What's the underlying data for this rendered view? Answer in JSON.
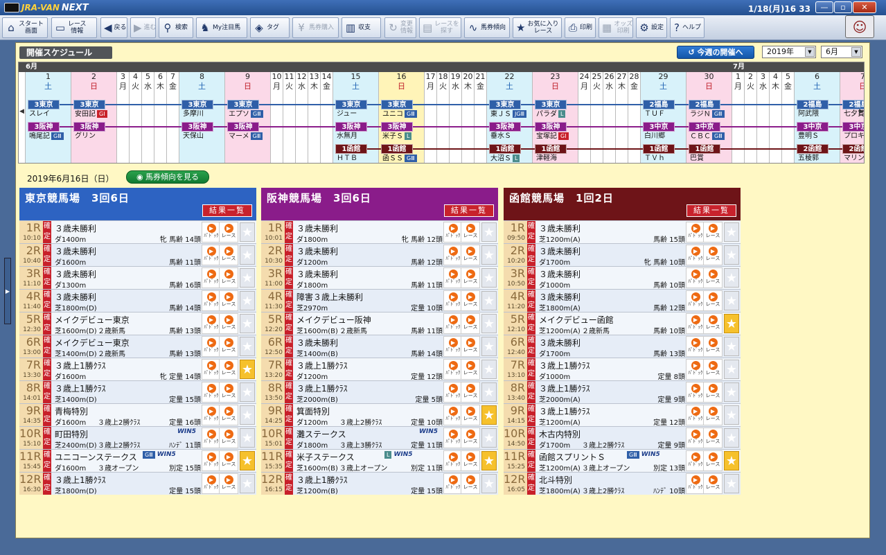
{
  "app": {
    "logo_main": "JRA-VAN",
    "logo_sub": "NEXT",
    "clock": "1/18(月)16 33"
  },
  "window_buttons": [
    "—",
    "▫",
    "✕"
  ],
  "toolbar": [
    {
      "label": "スタート\n画面",
      "icon": "home-icon",
      "glyph": "⌂",
      "enabled": true
    },
    {
      "label": "レース\n情報",
      "icon": "race-info-icon",
      "glyph": "▭",
      "enabled": true
    },
    {
      "label": "戻る",
      "icon": "back-icon",
      "glyph": "◀",
      "enabled": true
    },
    {
      "label": "進む",
      "icon": "forward-icon",
      "glyph": "▶",
      "enabled": false
    },
    {
      "label": "検索",
      "icon": "search-icon",
      "glyph": "⚲",
      "enabled": true
    },
    {
      "label": "My注目馬",
      "icon": "horse-icon",
      "glyph": "♞",
      "enabled": true
    },
    {
      "label": "タグ",
      "icon": "tag-icon",
      "glyph": "◈",
      "enabled": true
    },
    {
      "label": "馬券購入",
      "icon": "yen-icon",
      "glyph": "¥",
      "enabled": false
    },
    {
      "label": "収支",
      "icon": "balance-chart-icon",
      "glyph": "▥",
      "enabled": true
    },
    {
      "label": "変更\n情報",
      "icon": "change-info-icon",
      "glyph": "↻",
      "enabled": false
    },
    {
      "label": "レースを\n探す",
      "icon": "find-race-icon",
      "glyph": "▤",
      "enabled": false
    },
    {
      "label": "馬券傾向",
      "icon": "trend-icon",
      "glyph": "∿",
      "enabled": true
    },
    {
      "label": "お気に入り\nレース",
      "icon": "star-icon",
      "glyph": "★",
      "enabled": true
    },
    {
      "label": "印刷",
      "icon": "print-icon",
      "glyph": "⎙",
      "enabled": true
    },
    {
      "label": "オッズ\n印刷",
      "icon": "odds-print-icon",
      "glyph": "▦",
      "enabled": false
    },
    {
      "label": "設定",
      "icon": "gear-icon",
      "glyph": "⚙",
      "enabled": true
    },
    {
      "label": "ヘルプ",
      "icon": "help-icon",
      "glyph": "?",
      "enabled": true
    }
  ],
  "schedule": {
    "title": "開催スケジュール",
    "this_week_button": "今週の開催へ",
    "year_value": "2019年",
    "month_value": "6月",
    "month_labels": [
      "6月",
      "7月"
    ]
  },
  "calendar": {
    "days": [
      {
        "d": "1",
        "w": "土"
      },
      {
        "d": "2",
        "w": "日"
      },
      {
        "d": "3",
        "w": "月"
      },
      {
        "d": "4",
        "w": "火"
      },
      {
        "d": "5",
        "w": "水"
      },
      {
        "d": "6",
        "w": "木"
      },
      {
        "d": "7",
        "w": "金"
      },
      {
        "d": "8",
        "w": "土"
      },
      {
        "d": "9",
        "w": "日"
      },
      {
        "d": "10",
        "w": "月"
      },
      {
        "d": "11",
        "w": "火"
      },
      {
        "d": "12",
        "w": "水"
      },
      {
        "d": "13",
        "w": "木"
      },
      {
        "d": "14",
        "w": "金"
      },
      {
        "d": "15",
        "w": "土"
      },
      {
        "d": "16",
        "w": "日"
      },
      {
        "d": "17",
        "w": "月"
      },
      {
        "d": "18",
        "w": "火"
      },
      {
        "d": "19",
        "w": "水"
      },
      {
        "d": "20",
        "w": "木"
      },
      {
        "d": "21",
        "w": "金"
      },
      {
        "d": "22",
        "w": "土"
      },
      {
        "d": "23",
        "w": "日"
      },
      {
        "d": "24",
        "w": "月"
      },
      {
        "d": "25",
        "w": "火"
      },
      {
        "d": "26",
        "w": "水"
      },
      {
        "d": "27",
        "w": "木"
      },
      {
        "d": "28",
        "w": "金"
      },
      {
        "d": "29",
        "w": "土"
      },
      {
        "d": "30",
        "w": "日"
      },
      {
        "d": "1",
        "w": "月"
      },
      {
        "d": "2",
        "w": "火"
      },
      {
        "d": "3",
        "w": "水"
      },
      {
        "d": "4",
        "w": "木"
      },
      {
        "d": "5",
        "w": "金"
      },
      {
        "d": "6",
        "w": "土"
      },
      {
        "d": "7",
        "w": "日"
      }
    ],
    "rows": [
      {
        "color": "#2f5fa8",
        "events": [
          {
            "di": 0,
            "v": "3東京",
            "g": "スレイ",
            "gr": ""
          },
          {
            "di": 1,
            "v": "3東京",
            "g": "安田記",
            "gr": "GⅠ"
          },
          {
            "di": 7,
            "v": "3東京",
            "g": "多摩川",
            "gr": ""
          },
          {
            "di": 8,
            "v": "3東京",
            "g": "エプソ",
            "gr": "GⅢ"
          },
          {
            "di": 14,
            "v": "3東京",
            "g": "ジュー",
            "gr": ""
          },
          {
            "di": 15,
            "v": "3東京",
            "g": "ユニコ",
            "gr": "GⅢ"
          },
          {
            "di": 21,
            "v": "3東京",
            "g": "東ＪＳ",
            "gr": "JGⅢ"
          },
          {
            "di": 22,
            "v": "3東京",
            "g": "パラダ",
            "gr": "L"
          },
          {
            "di": 28,
            "v": "2福島",
            "g": "ＴＵＦ",
            "gr": ""
          },
          {
            "di": 29,
            "v": "2福島",
            "g": "ラジＮ",
            "gr": "GⅢ"
          },
          {
            "di": 35,
            "v": "2福島",
            "g": "阿武隈",
            "gr": ""
          },
          {
            "di": 36,
            "v": "2福島",
            "g": "七夕賞",
            "gr": ""
          }
        ]
      },
      {
        "color": "#8a1c8a",
        "events": [
          {
            "di": 0,
            "v": "3阪神",
            "g": "鳴尾記",
            "gr": "GⅢ"
          },
          {
            "di": 1,
            "v": "3阪神",
            "g": "グリン",
            "gr": ""
          },
          {
            "di": 7,
            "v": "3阪神",
            "g": "天保山",
            "gr": ""
          },
          {
            "di": 8,
            "v": "3阪神",
            "g": "マーメ",
            "gr": "GⅢ"
          },
          {
            "di": 14,
            "v": "3阪神",
            "g": "水無月",
            "gr": ""
          },
          {
            "di": 15,
            "v": "3阪神",
            "g": "米子Ｓ",
            "gr": "L"
          },
          {
            "di": 21,
            "v": "3阪神",
            "g": "垂水Ｓ",
            "gr": ""
          },
          {
            "di": 22,
            "v": "3阪神",
            "g": "宝塚記",
            "gr": "GⅠ"
          },
          {
            "di": 28,
            "v": "3中京",
            "g": "白川郷",
            "gr": ""
          },
          {
            "di": 29,
            "v": "3中京",
            "g": "ＣＢＣ",
            "gr": "GⅢ"
          },
          {
            "di": 35,
            "v": "3中京",
            "g": "豊明Ｓ",
            "gr": ""
          },
          {
            "di": 36,
            "v": "3中京",
            "g": "プロキ",
            "gr": ""
          }
        ]
      },
      {
        "color": "#6e1418",
        "events": [
          {
            "di": 14,
            "v": "1函館",
            "g": "ＨＴＢ",
            "gr": ""
          },
          {
            "di": 15,
            "v": "1函館",
            "g": "函ＳＳ",
            "gr": "GⅢ"
          },
          {
            "di": 21,
            "v": "1函館",
            "g": "大沼Ｓ",
            "gr": "L"
          },
          {
            "di": 22,
            "v": "1函館",
            "g": "津軽海",
            "gr": ""
          },
          {
            "di": 28,
            "v": "1函館",
            "g": "ＴＶｈ",
            "gr": ""
          },
          {
            "di": 29,
            "v": "1函館",
            "g": "巴賞",
            "gr": ""
          },
          {
            "di": 35,
            "v": "2函館",
            "g": "五稜郭",
            "gr": ""
          },
          {
            "di": 36,
            "v": "2函館",
            "g": "マリン",
            "gr": ""
          }
        ]
      }
    ]
  },
  "selected_date": "2019年6月16日（日）",
  "trend_button": "馬券傾向を見る",
  "result_button": "結果一覧",
  "kakutei": "確定",
  "icon_labels": {
    "paddock": "ﾊﾟﾄﾞｯｸ",
    "race": "レース"
  },
  "venues": [
    {
      "name": "東京競馬場　3回6日",
      "color": "#2d63c2",
      "races": [
        {
          "no": "1R",
          "time": "10:10",
          "name": "３歳未勝利",
          "course": "ダ1400m",
          "cond": "",
          "info": "牝 馬齢 14頭",
          "grades": [],
          "w5": false,
          "fav": false
        },
        {
          "no": "2R",
          "time": "10:40",
          "name": "３歳未勝利",
          "course": "ダ1600m",
          "cond": "",
          "info": "馬齢 11頭",
          "grades": [],
          "w5": false,
          "fav": false
        },
        {
          "no": "3R",
          "time": "11:10",
          "name": "３歳未勝利",
          "course": "ダ1300m",
          "cond": "",
          "info": "馬齢 16頭",
          "grades": [],
          "w5": false,
          "fav": false
        },
        {
          "no": "4R",
          "time": "11:40",
          "name": "３歳未勝利",
          "course": "芝1800m(D)",
          "cond": "",
          "info": "馬齢 14頭",
          "grades": [],
          "w5": false,
          "fav": false
        },
        {
          "no": "5R",
          "time": "12:30",
          "name": "メイクデビュー東京",
          "course": "芝1600m(D)",
          "cond": "２歳新馬",
          "info": "馬齢 13頭",
          "grades": [],
          "w5": false,
          "fav": false
        },
        {
          "no": "6R",
          "time": "13:00",
          "name": "メイクデビュー東京",
          "course": "芝1400m(D)",
          "cond": "２歳新馬",
          "info": "馬齢 13頭",
          "grades": [],
          "w5": false,
          "fav": false
        },
        {
          "no": "7R",
          "time": "13:30",
          "name": "３歳上1勝ｸﾗｽ",
          "course": "ダ1600m",
          "cond": "",
          "info": "牝 定量 14頭",
          "grades": [],
          "w5": false,
          "fav": true
        },
        {
          "no": "8R",
          "time": "14:01",
          "name": "３歳上1勝ｸﾗｽ",
          "course": "芝1400m(D)",
          "cond": "",
          "info": "定量 15頭",
          "grades": [],
          "w5": false,
          "fav": false
        },
        {
          "no": "9R",
          "time": "14:35",
          "name": "青梅特別",
          "course": "ダ1600m",
          "cond": "３歳上2勝ｸﾗｽ",
          "info": "定量 16頭",
          "grades": [],
          "w5": false,
          "fav": false
        },
        {
          "no": "10R",
          "time": "15:10",
          "name": "町田特別",
          "course": "芝2400m(D)",
          "cond": "３歳上2勝ｸﾗｽ",
          "info": "ﾊﾝﾃﾞ 11頭",
          "grades": [],
          "w5": true,
          "fav": false
        },
        {
          "no": "11R",
          "time": "15:45",
          "name": "ユニコーンステークス",
          "course": "ダ1600m",
          "cond": "３歳オープン",
          "info": "別定 15頭",
          "grades": [
            "GⅢ"
          ],
          "w5": true,
          "fav": true
        },
        {
          "no": "12R",
          "time": "16:30",
          "name": "３歳上1勝ｸﾗｽ",
          "course": "芝1800m(D)",
          "cond": "",
          "info": "定量 15頭",
          "grades": [],
          "w5": false,
          "fav": false
        }
      ]
    },
    {
      "name": "阪神競馬場　3回6日",
      "color": "#8a1c8a",
      "races": [
        {
          "no": "1R",
          "time": "10:01",
          "name": "３歳未勝利",
          "course": "ダ1800m",
          "cond": "",
          "info": "牝 馬齢 12頭",
          "grades": [],
          "w5": false,
          "fav": false
        },
        {
          "no": "2R",
          "time": "10:30",
          "name": "３歳未勝利",
          "course": "ダ1200m",
          "cond": "",
          "info": "馬齢 12頭",
          "grades": [],
          "w5": false,
          "fav": false
        },
        {
          "no": "3R",
          "time": "11:00",
          "name": "３歳未勝利",
          "course": "ダ1800m",
          "cond": "",
          "info": "馬齢 11頭",
          "grades": [],
          "w5": false,
          "fav": false
        },
        {
          "no": "4R",
          "time": "11:30",
          "name": "障害３歳上未勝利",
          "course": "芝2970m",
          "cond": "",
          "info": "定量 10頭",
          "grades": [],
          "w5": false,
          "fav": false
        },
        {
          "no": "5R",
          "time": "12:20",
          "name": "メイクデビュー阪神",
          "course": "芝1600m(B)",
          "cond": "２歳新馬",
          "info": "馬齢 11頭",
          "grades": [],
          "w5": false,
          "fav": false
        },
        {
          "no": "6R",
          "time": "12:50",
          "name": "３歳未勝利",
          "course": "芝1400m(B)",
          "cond": "",
          "info": "馬齢 14頭",
          "grades": [],
          "w5": false,
          "fav": false
        },
        {
          "no": "7R",
          "time": "13:20",
          "name": "３歳上1勝ｸﾗｽ",
          "course": "ダ1200m",
          "cond": "",
          "info": "定量 12頭",
          "grades": [],
          "w5": false,
          "fav": false
        },
        {
          "no": "8R",
          "time": "13:50",
          "name": "３歳上1勝ｸﾗｽ",
          "course": "芝2000m(B)",
          "cond": "",
          "info": "定量 5頭",
          "grades": [],
          "w5": false,
          "fav": false
        },
        {
          "no": "9R",
          "time": "14:25",
          "name": "箕面特別",
          "course": "ダ1200m",
          "cond": "３歳上2勝ｸﾗｽ",
          "info": "定量 10頭",
          "grades": [],
          "w5": false,
          "fav": true
        },
        {
          "no": "10R",
          "time": "15:01",
          "name": "灘ステークス",
          "course": "ダ1800m",
          "cond": "３歳上3勝ｸﾗｽ",
          "info": "定量 11頭",
          "grades": [],
          "w5": true,
          "fav": false
        },
        {
          "no": "11R",
          "time": "15:35",
          "name": "米子ステークス",
          "course": "芝1600m(B)",
          "cond": "３歳上オープン",
          "info": "別定 11頭",
          "grades": [
            "L"
          ],
          "w5": true,
          "fav": true
        },
        {
          "no": "12R",
          "time": "16:15",
          "name": "３歳上1勝ｸﾗｽ",
          "course": "芝1200m(B)",
          "cond": "",
          "info": "定量 15頭",
          "grades": [],
          "w5": false,
          "fav": false
        }
      ]
    },
    {
      "name": "函館競馬場　1回2日",
      "color": "#6e1418",
      "races": [
        {
          "no": "1R",
          "time": "09:50",
          "name": "３歳未勝利",
          "course": "芝1200m(A)",
          "cond": "",
          "info": "馬齢 15頭",
          "grades": [],
          "w5": false,
          "fav": false
        },
        {
          "no": "2R",
          "time": "10:20",
          "name": "３歳未勝利",
          "course": "ダ1700m",
          "cond": "",
          "info": "牝 馬齢 10頭",
          "grades": [],
          "w5": false,
          "fav": false
        },
        {
          "no": "3R",
          "time": "10:50",
          "name": "３歳未勝利",
          "course": "ダ1000m",
          "cond": "",
          "info": "馬齢 10頭",
          "grades": [],
          "w5": false,
          "fav": false
        },
        {
          "no": "4R",
          "time": "11:20",
          "name": "３歳未勝利",
          "course": "芝1800m(A)",
          "cond": "",
          "info": "馬齢 12頭",
          "grades": [],
          "w5": false,
          "fav": false
        },
        {
          "no": "5R",
          "time": "12:10",
          "name": "メイクデビュー函館",
          "course": "芝1200m(A)",
          "cond": "２歳新馬",
          "info": "馬齢 10頭",
          "grades": [],
          "w5": false,
          "fav": true
        },
        {
          "no": "6R",
          "time": "12:40",
          "name": "３歳未勝利",
          "course": "ダ1700m",
          "cond": "",
          "info": "馬齢 13頭",
          "grades": [],
          "w5": false,
          "fav": false
        },
        {
          "no": "7R",
          "time": "13:10",
          "name": "３歳上1勝ｸﾗｽ",
          "course": "ダ1000m",
          "cond": "",
          "info": "定量 8頭",
          "grades": [],
          "w5": false,
          "fav": false
        },
        {
          "no": "8R",
          "time": "13:40",
          "name": "３歳上1勝ｸﾗｽ",
          "course": "芝2000m(A)",
          "cond": "",
          "info": "定量 9頭",
          "grades": [],
          "w5": false,
          "fav": false
        },
        {
          "no": "9R",
          "time": "14:15",
          "name": "３歳上1勝ｸﾗｽ",
          "course": "芝1200m(A)",
          "cond": "",
          "info": "定量 12頭",
          "grades": [],
          "w5": false,
          "fav": false
        },
        {
          "no": "10R",
          "time": "14:50",
          "name": "木古内特別",
          "course": "ダ1700m",
          "cond": "３歳上2勝ｸﾗｽ",
          "info": "定量 9頭",
          "grades": [],
          "w5": false,
          "fav": false
        },
        {
          "no": "11R",
          "time": "15:25",
          "name": "函館スプリントＳ",
          "course": "芝1200m(A)",
          "cond": "３歳上オープン",
          "info": "別定 13頭",
          "grades": [
            "GⅢ"
          ],
          "w5": true,
          "fav": true
        },
        {
          "no": "12R",
          "time": "16:05",
          "name": "北斗特別",
          "course": "芝1800m(A)",
          "cond": "３歳上2勝ｸﾗｽ",
          "info": "ﾊﾝﾃﾞ 10頭",
          "grades": [],
          "w5": false,
          "fav": false
        }
      ]
    }
  ],
  "colors": {
    "accent": "#1456a8",
    "panel_bg": "#fff8c4",
    "kakutei": "#c8202a",
    "fav": "#f6c12c"
  }
}
